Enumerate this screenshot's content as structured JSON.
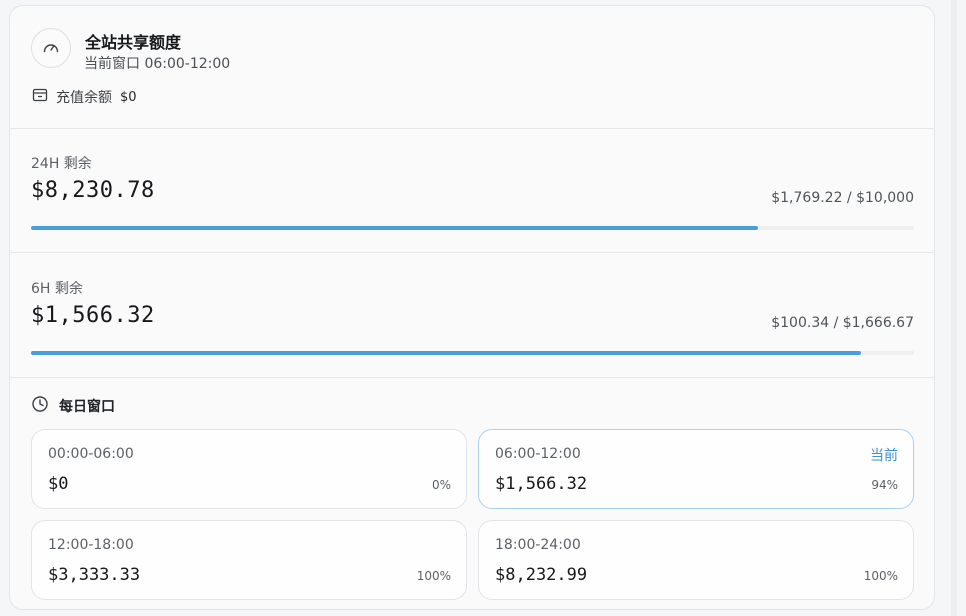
{
  "header": {
    "title": "全站共享额度",
    "subtitle": "当前窗口 06:00-12:00",
    "balance_label": "充值余额",
    "balance_value": "$0"
  },
  "quota_24h": {
    "label": "24H 剩余",
    "amount": "$8,230.78",
    "ratio": "$1,769.22 / $10,000",
    "fill_fraction": 0.823
  },
  "quota_6h": {
    "label": "6H 剩余",
    "amount": "$1,566.32",
    "ratio": "$100.34 / $1,666.67",
    "fill_fraction": 0.94
  },
  "daily": {
    "title": "每日窗口",
    "slots": [
      {
        "range": "00:00-06:00",
        "amount": "$0",
        "pct": "0%",
        "badge": ""
      },
      {
        "range": "06:00-12:00",
        "amount": "$1,566.32",
        "pct": "94%",
        "badge": "当前"
      },
      {
        "range": "12:00-18:00",
        "amount": "$3,333.33",
        "pct": "100%",
        "badge": ""
      },
      {
        "range": "18:00-24:00",
        "amount": "$8,232.99",
        "pct": "100%",
        "badge": ""
      }
    ]
  },
  "colors": {
    "accent": "#4a9edb",
    "current_border": "#a8d2ee",
    "badge": "#3a93d3"
  },
  "icons": {
    "header": "gauge-icon",
    "balance": "wallet-icon",
    "daily": "clock-icon"
  }
}
